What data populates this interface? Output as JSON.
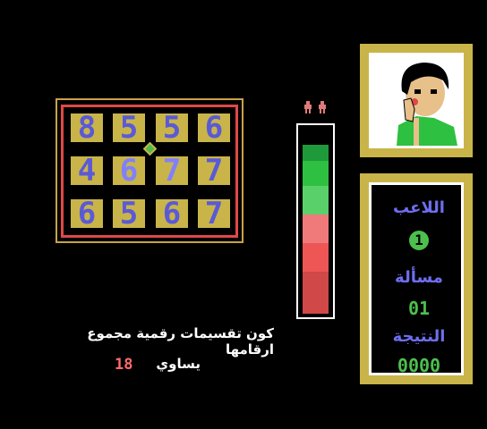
{
  "board": {
    "rows": [
      [
        "8",
        "5",
        "5",
        "6"
      ],
      [
        "4",
        "6",
        "7",
        "7"
      ],
      [
        "6",
        "5",
        "6",
        "7"
      ]
    ]
  },
  "lives": 2,
  "timer": {
    "segment_colors": [
      "#000000",
      "#1f9a3a",
      "#2ec040",
      "#5ad06a",
      "#f07a7a",
      "#ee5555",
      "#d04848"
    ]
  },
  "side_panel": {
    "player_label": "اللاعب",
    "player_value": "1",
    "question_label": "مسألة",
    "question_value": "01",
    "score_label": "النتيجة",
    "score_value": "0000"
  },
  "prompt": {
    "question": "كون تقسيمات رقمية مجموع ارقامها",
    "equals": "يساوي",
    "target": "18"
  },
  "colors": {
    "frame": "#c9b44a",
    "tile": "#c9b44a",
    "digit": "#5a5ad6",
    "accent_red": "#e04848",
    "accent_green": "#4cbf4c"
  }
}
